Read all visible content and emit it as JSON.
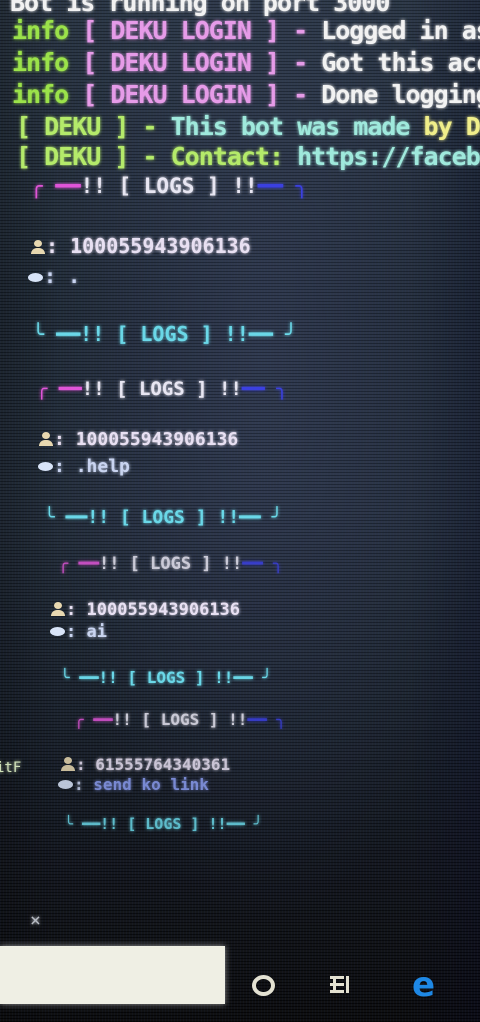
{
  "terminal": {
    "top_line": "Bot is running on port 3000",
    "info_lines": [
      {
        "level": "info",
        "tag": "[ DEKU LOGIN ]",
        "sep": "-",
        "text": "Logged in as"
      },
      {
        "level": "info",
        "tag": "[ DEKU LOGIN ]",
        "sep": "-",
        "text": "Got this acc"
      },
      {
        "level": "info",
        "tag": "[ DEKU LOGIN ]",
        "sep": "-",
        "text": "Done logging"
      }
    ],
    "deku_lines": [
      {
        "tag": "[ DEKU ]",
        "sep": "-",
        "text_a": "This bot was made ",
        "text_b": "by De"
      },
      {
        "tag": "[ DEKU ]",
        "sep": "-",
        "text_a": "Contact: ",
        "text_b": "https://facebo"
      }
    ],
    "log_header": {
      "open": "╭ ━━",
      "label": "!! [ LOGS ] !!",
      "close": "━━ ╮"
    },
    "log_footer": {
      "open": "╰ ━━",
      "label": "!! [ LOGS ] !!",
      "close": "━━ ╯"
    },
    "logs": [
      {
        "user_id": "100055943906136",
        "message": "."
      },
      {
        "user_id": "100055943906136",
        "message": ".help"
      },
      {
        "user_id": "100055943906136",
        "message": "ai"
      },
      {
        "user_id": "61555764340361",
        "message": "send ko link"
      }
    ],
    "separator": ":",
    "icons": {
      "user": "bust-in-silhouette-icon",
      "message": "speech-bubble-icon"
    }
  },
  "side_text": "itF",
  "close_glyph": "×",
  "taskbar": {
    "icons": [
      "cortana-circle-icon",
      "task-view-icon",
      "edge-browser-icon"
    ],
    "edge_color": "#1e88e5"
  }
}
